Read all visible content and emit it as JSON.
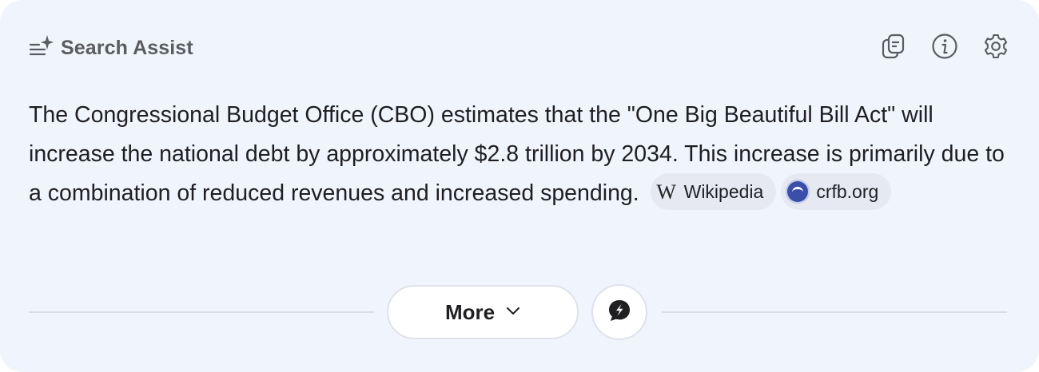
{
  "header": {
    "title": "Search Assist",
    "title_icon": "sparkle-list-icon",
    "actions": [
      {
        "icon": "copy-icon"
      },
      {
        "icon": "info-icon"
      },
      {
        "icon": "gear-icon"
      }
    ]
  },
  "answer": {
    "text": "The Congressional Budget Office (CBO) estimates that the \"One Big Beautiful Bill Act\" will increase the national debt by approximately $2.8 trillion by 2034. This increase is primarily due to a combination of reduced revenues and increased spending.",
    "sources": [
      {
        "label": "Wikipedia",
        "glyph": "W",
        "icon": "wikipedia-icon"
      },
      {
        "label": "crfb.org",
        "icon": "crfb-logo-icon"
      }
    ]
  },
  "footer": {
    "more_label": "More",
    "more_icon": "chevron-down-icon",
    "chat_icon": "chat-bubble-icon"
  },
  "colors": {
    "card_background": "#f0f4fd",
    "text": "#1f1f22",
    "muted": "#5b5c61",
    "chip_background": "#e6e9f2"
  }
}
